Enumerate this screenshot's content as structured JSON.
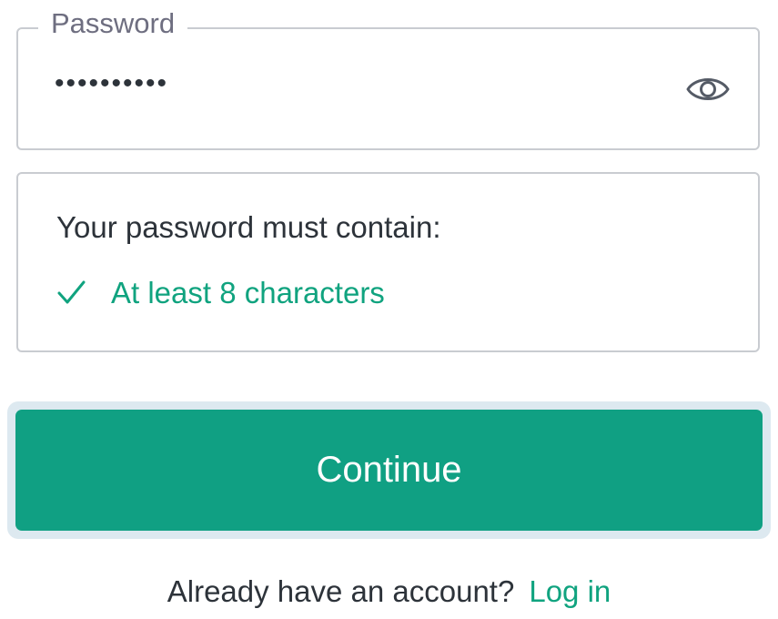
{
  "password_field": {
    "label": "Password",
    "value": "••••••••••",
    "toggle_icon": "eye-icon"
  },
  "requirements": {
    "title": "Your password must contain:",
    "items": [
      {
        "icon": "check-icon",
        "text": "At least 8 characters",
        "satisfied": true
      }
    ]
  },
  "continue_button": {
    "label": "Continue"
  },
  "footer": {
    "prompt": "Already have an account?",
    "login_link": "Log in"
  },
  "colors": {
    "accent": "#10a37f",
    "button_bg": "#10a083",
    "border": "#c9ccd1",
    "text": "#2d333a",
    "label": "#6e6e80"
  }
}
